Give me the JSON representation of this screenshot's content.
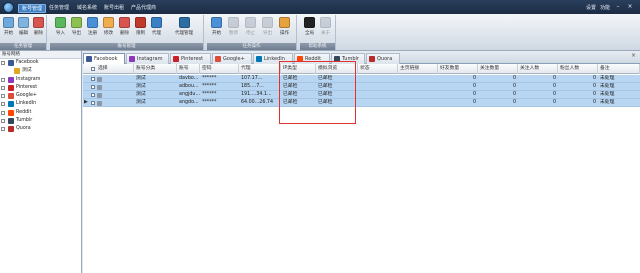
{
  "menu": {
    "items": [
      "账号管理",
      "任务管理",
      "域名系统",
      "账号出租",
      "产品代理商"
    ],
    "active_index": 0,
    "right": [
      "设置",
      "功能"
    ]
  },
  "ribbon": {
    "groups": [
      {
        "title": "任务管理",
        "buttons": [
          "开始",
          "编辑",
          "删除"
        ]
      },
      {
        "title": "账号管理",
        "buttons": [
          "导入",
          "导出",
          "注册",
          "修改",
          "删除",
          "限制",
          "代理",
          "代理管理"
        ]
      },
      {
        "title": "任务操作",
        "buttons": [
          "开始",
          "暂停",
          "停止",
          "导出",
          "操作"
        ]
      },
      {
        "title": "帮助系统",
        "buttons": [
          "全局",
          "关于"
        ]
      }
    ]
  },
  "left_panel": {
    "header": "账号网络",
    "items": [
      {
        "label": "Facebook",
        "icon": "facebook-icon",
        "color": "#3b5998",
        "child": false
      },
      {
        "label": "测试",
        "icon": "folder-icon",
        "color": "#e0a81e",
        "child": true
      },
      {
        "label": "Instagram",
        "icon": "instagram-icon",
        "color": "#8a3ab9",
        "child": false
      },
      {
        "label": "Pinterest",
        "icon": "pinterest-icon",
        "color": "#cb2027",
        "child": false
      },
      {
        "label": "Google+",
        "icon": "googleplus-icon",
        "color": "#dd4b39",
        "child": false
      },
      {
        "label": "LinkedIn",
        "icon": "linkedin-icon",
        "color": "#0077b5",
        "child": false
      },
      {
        "label": "Reddit",
        "icon": "reddit-icon",
        "color": "#ff4500",
        "child": false
      },
      {
        "label": "Tumblr",
        "icon": "tumblr-icon",
        "color": "#35465c",
        "child": false
      },
      {
        "label": "Quora",
        "icon": "quora-icon",
        "color": "#b92b27",
        "child": false
      }
    ]
  },
  "tabs": [
    {
      "label": "Facebook",
      "icon": "facebook-icon",
      "color": "#3b5998",
      "active": true
    },
    {
      "label": "Instagram",
      "icon": "instagram-icon",
      "color": "#8a3ab9",
      "active": false
    },
    {
      "label": "Pinterest",
      "icon": "pinterest-icon",
      "color": "#cb2027",
      "active": false
    },
    {
      "label": "Google+",
      "icon": "googleplus-icon",
      "color": "#dd4b39",
      "active": false
    },
    {
      "label": "LinkedIn",
      "icon": "linkedin-icon",
      "color": "#0077b5",
      "active": false
    },
    {
      "label": "Reddit",
      "icon": "reddit-icon",
      "color": "#ff4500",
      "active": false
    },
    {
      "label": "Tumblr",
      "icon": "tumblr-icon",
      "color": "#35465c",
      "active": false
    },
    {
      "label": "Quora",
      "icon": "quora-icon",
      "color": "#b92b27",
      "active": false
    }
  ],
  "grid": {
    "columns": [
      "选择",
      "账号分类",
      "账号",
      "密码",
      "代理",
      "IP类型",
      "模拟浏览",
      "状态",
      "主页链接",
      "好友数量",
      "关注数量",
      "关注人数",
      "粉丝人数",
      "备注"
    ],
    "rows": [
      {
        "marker": "",
        "category": "测试",
        "account": "davbo...",
        "password": "******",
        "proxy": "107.17...",
        "ip_type": "已邮检",
        "emulation": "已邮检",
        "status": "",
        "homepage": "",
        "friends": "0",
        "follows": "0",
        "followers": "0",
        "fans": "0",
        "note": "未处理"
      },
      {
        "marker": "",
        "category": "测试",
        "account": "adbou...",
        "password": "******",
        "proxy": "185....7...",
        "ip_type": "已邮检",
        "emulation": "已邮检",
        "status": "",
        "homepage": "",
        "friends": "0",
        "follows": "0",
        "followers": "0",
        "fans": "0",
        "note": "未处理"
      },
      {
        "marker": "",
        "category": "测试",
        "account": "angjdu...",
        "password": "******",
        "proxy": "191....34.1...",
        "ip_type": "已邮检",
        "emulation": "已邮检",
        "status": "",
        "homepage": "",
        "friends": "0",
        "follows": "0",
        "followers": "0",
        "fans": "0",
        "note": "未处理"
      },
      {
        "marker": "▶",
        "category": "测试",
        "account": "angdo...",
        "password": "******",
        "proxy": "64.00...26.74",
        "ip_type": "已邮检",
        "emulation": "已邮检",
        "status": "",
        "homepage": "",
        "friends": "0",
        "follows": "0",
        "followers": "0",
        "fans": "0",
        "note": "未处理"
      }
    ]
  },
  "colors": {
    "titlebar": "#1c2c44",
    "row_selected": "#b8d6f2",
    "highlight_box": "#e03030"
  }
}
